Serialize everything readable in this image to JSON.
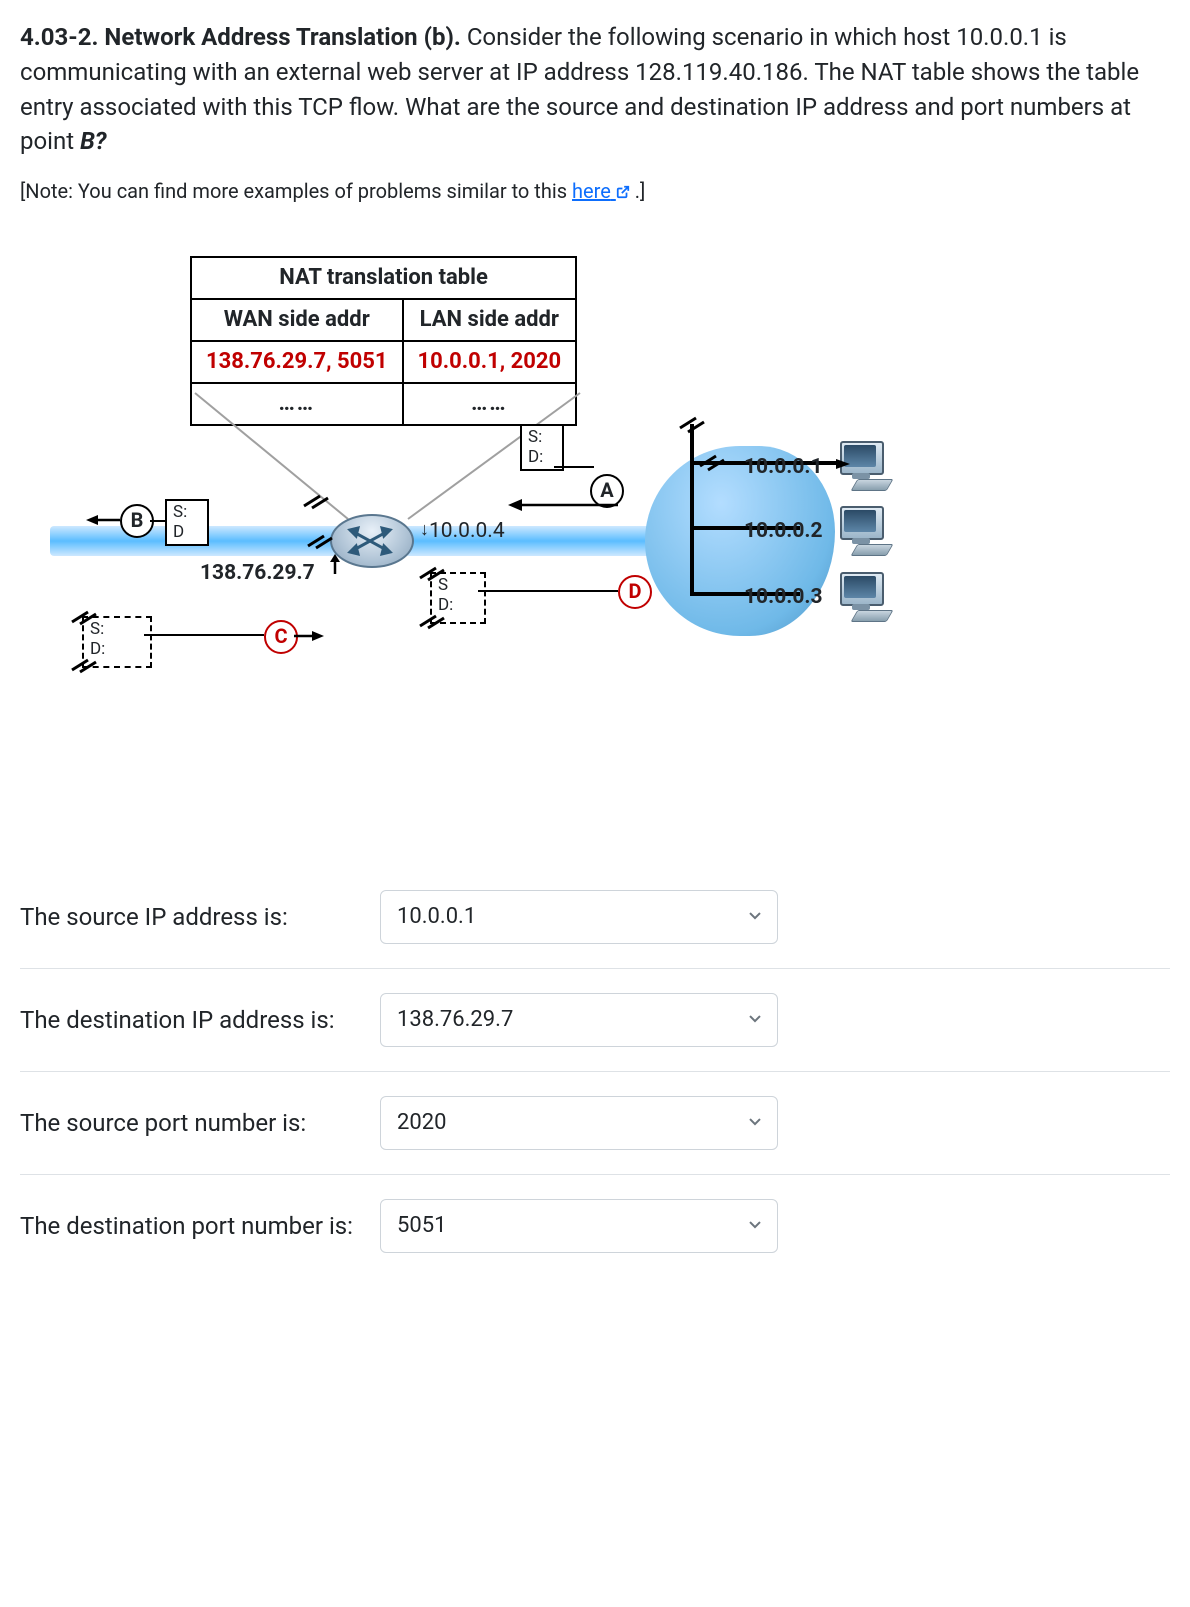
{
  "question": {
    "number": "4.03-2. Network Address Translation (b).",
    "body_1": "Consider the following scenario in which host 10.0.0.1 is communicating with an external web server at IP address 128.119.40.186.  The NAT table shows the table entry associated with this TCP flow.  What are the source and destination IP address and port numbers at point ",
    "point": "B?"
  },
  "note": {
    "prefix": "[Note: You can find more examples of problems similar to this ",
    "link_text": "here",
    "suffix": " .]"
  },
  "nat_table": {
    "title": "NAT translation table",
    "col_wan": "WAN side addr",
    "col_lan": "LAN side addr",
    "row_wan": "138.76.29.7, 5051",
    "row_lan": "10.0.0.1, 2020",
    "dots": "……"
  },
  "diagram": {
    "router_wan_ip": "138.76.29.7",
    "router_lan_ip": "10.0.0.4",
    "host1": "10.0.0.1",
    "host2": "10.0.0.2",
    "host3": "10.0.0.3",
    "s_label": "S:",
    "d_label": "D:",
    "s_only": "S",
    "d_only": "D",
    "labelA": "A",
    "labelB": "B",
    "labelC": "C",
    "labelD": "D"
  },
  "answers": {
    "rows": [
      {
        "label": "The source IP address is:",
        "value": "10.0.0.1"
      },
      {
        "label": "The destination IP address is:",
        "value": "138.76.29.7"
      },
      {
        "label": "The source port number is:",
        "value": "2020"
      },
      {
        "label": "The destination port number is:",
        "value": "5051"
      }
    ]
  }
}
